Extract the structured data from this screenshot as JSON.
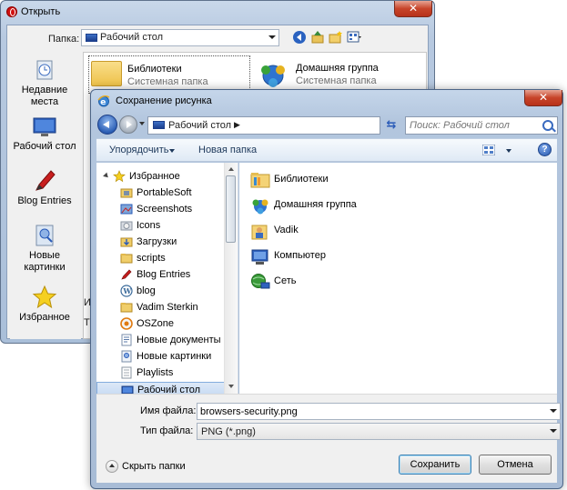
{
  "open_dialog": {
    "title": "Открыть",
    "folder_label": "Папка:",
    "folder_value": "Рабочий стол",
    "places": [
      {
        "label": "Недавние места",
        "icon": "recent-places-icon"
      },
      {
        "label": "Рабочий стол",
        "icon": "desktop-icon",
        "selected": true
      },
      {
        "label": "Blog Entries",
        "icon": "blog-entries-icon"
      },
      {
        "label": "Новые картинки",
        "icon": "new-pictures-icon"
      },
      {
        "label": "Избранное",
        "icon": "star-icon"
      }
    ],
    "items": [
      {
        "title": "Библиотеки",
        "subtitle": "Системная папка",
        "icon": "libraries-icon"
      },
      {
        "title": "Домашняя группа",
        "subtitle": "Системная папка",
        "icon": "homegroup-icon"
      }
    ],
    "partial_labels": [
      "И",
      "Т"
    ],
    "close_label": "✕"
  },
  "save_dialog": {
    "title": "Сохранение рисунка",
    "close_label": "✕",
    "address": "Рабочий стол",
    "search_placeholder": "Поиск: Рабочий стол",
    "toolbar": {
      "organize": "Упорядочить",
      "new_folder": "Новая папка",
      "help": "?"
    },
    "nav": {
      "favorites_header": "Избранное",
      "items": [
        {
          "label": "PortableSoft",
          "icon": "folder-icon"
        },
        {
          "label": "Screenshots",
          "icon": "screenshots-icon"
        },
        {
          "label": "Icons",
          "icon": "icons-folder-icon"
        },
        {
          "label": "Загрузки",
          "icon": "downloads-icon"
        },
        {
          "label": "scripts",
          "icon": "folder-icon"
        },
        {
          "label": "Blog Entries",
          "icon": "blog-entries-icon"
        },
        {
          "label": "blog",
          "icon": "wordpress-icon"
        },
        {
          "label": "Vadim Sterkin",
          "icon": "folder-icon"
        },
        {
          "label": "OSZone",
          "icon": "oszone-icon"
        },
        {
          "label": "Новые документы",
          "icon": "documents-icon"
        },
        {
          "label": "Новые картинки",
          "icon": "pictures-icon"
        },
        {
          "label": "Playlists",
          "icon": "playlists-icon"
        },
        {
          "label": "Рабочий стол",
          "icon": "desktop-icon",
          "selected": true
        }
      ]
    },
    "content_items": [
      {
        "label": "Библиотеки",
        "icon": "libraries-icon"
      },
      {
        "label": "Домашняя группа",
        "icon": "homegroup-icon"
      },
      {
        "label": "Vadik",
        "icon": "user-folder-icon"
      },
      {
        "label": "Компьютер",
        "icon": "computer-icon"
      },
      {
        "label": "Сеть",
        "icon": "network-icon"
      }
    ],
    "form": {
      "filename_label": "Имя файла:",
      "filename_value": "browsers-security.png",
      "filetype_label": "Тип файла:",
      "filetype_value": "PNG (*.png)",
      "hide_folders": "Скрыть папки",
      "save": "Сохранить",
      "cancel": "Отмена"
    }
  }
}
